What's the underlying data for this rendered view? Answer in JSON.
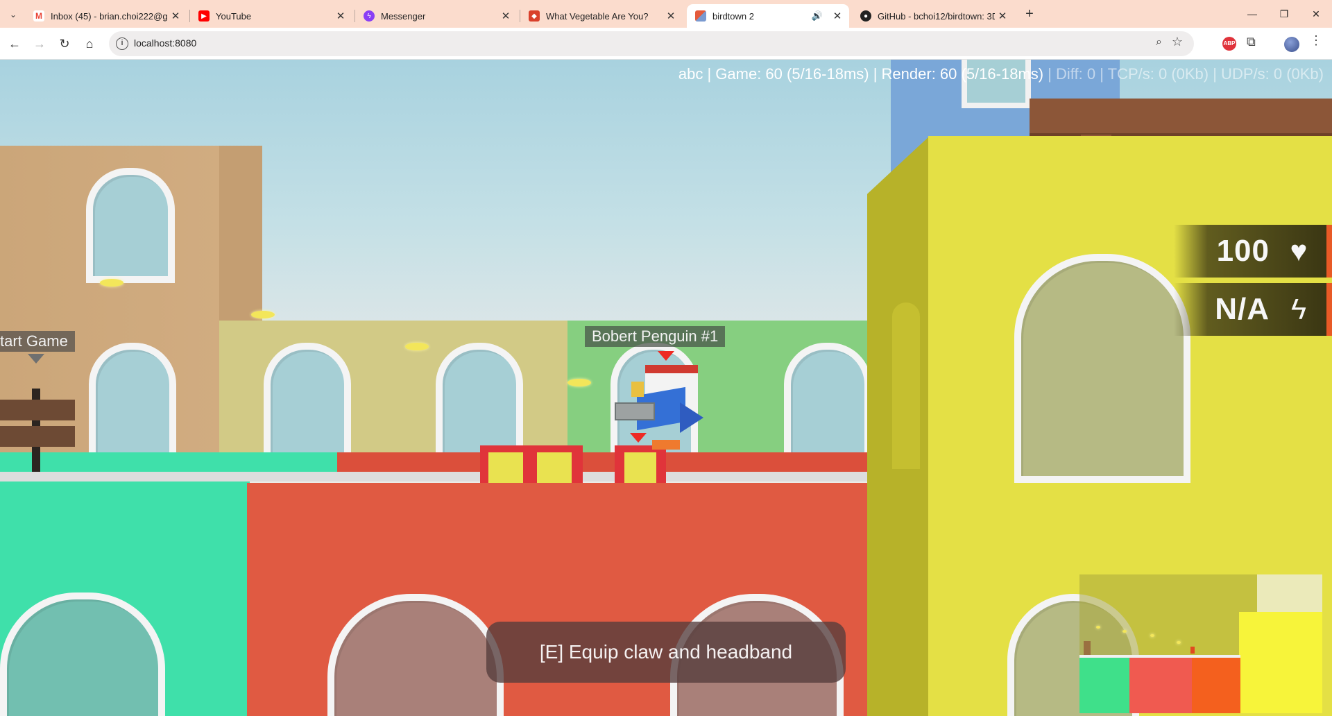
{
  "browser": {
    "tabs": [
      {
        "title": "Inbox (45) - brian.choi222@gm",
        "icon": "gmail-icon",
        "color": "#ea4335",
        "active": false
      },
      {
        "title": "YouTube",
        "icon": "youtube-icon",
        "color": "#ff0000",
        "active": false
      },
      {
        "title": "Messenger",
        "icon": "messenger-icon",
        "color": "#8a3ff5",
        "active": false
      },
      {
        "title": "What Vegetable Are You?",
        "icon": "quiz-icon",
        "color": "#d9402b",
        "active": false
      },
      {
        "title": "birdtown 2",
        "icon": "birdtown-icon",
        "color": "#7a9ad0",
        "active": true
      },
      {
        "title": "GitHub - bchoi12/birdtown: 3D",
        "icon": "github-icon",
        "color": "#222222",
        "active": false
      }
    ],
    "url": "localhost:8080"
  },
  "game": {
    "stats_main": "abc | Game: 60 (5/16-18ms) | Render: 60 (5/16-18ms)",
    "stats_extra": " | Diff: 0 | TCP/s: 0 (0Kb) | UDP/s: 0 (0Kb)",
    "player_name": "Bobert Penguin #1",
    "start_sign": "tart Game",
    "health": "100",
    "energy": "N/A",
    "prompt": "[E] Equip claw and headband",
    "colors": {
      "accent": "#e85a26",
      "red_building": "#e05a42",
      "teal_building": "#3fe0aa",
      "yellow_building": "#e4e045",
      "tan_building": "#cda878"
    }
  }
}
